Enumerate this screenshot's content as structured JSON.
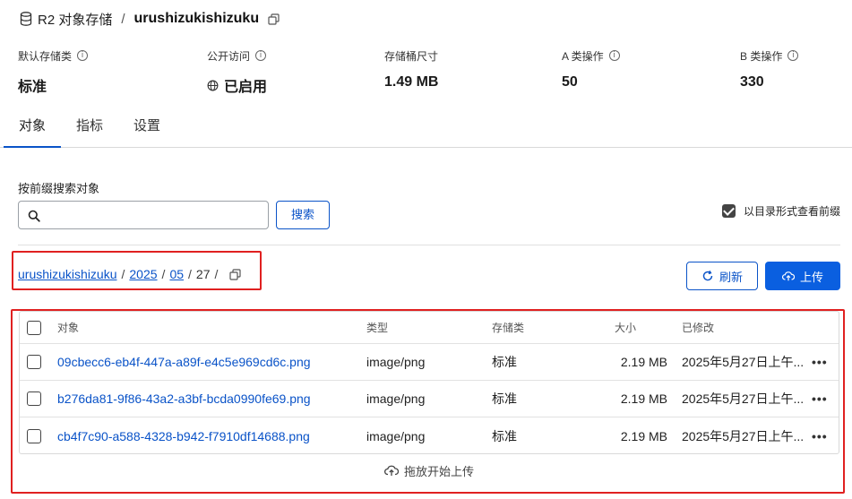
{
  "header": {
    "service": "R2 对象存储",
    "separator": "/",
    "bucket_name": "urushizukishizuku"
  },
  "stats": [
    {
      "label": "默认存储类",
      "value": "标准"
    },
    {
      "label": "公开访问",
      "value": "已启用"
    },
    {
      "label": "存储桶尺寸",
      "value": "1.49 MB"
    },
    {
      "label": "A 类操作",
      "value": "50"
    },
    {
      "label": "B 类操作",
      "value": "330"
    }
  ],
  "info_glyph": "i",
  "tabs": [
    "对象",
    "指标",
    "设置"
  ],
  "search": {
    "label": "按前缀搜索对象",
    "value": "",
    "placeholder": "",
    "button": "搜索"
  },
  "directory_view": {
    "label": "以目录形式查看前缀",
    "checked": true
  },
  "path": {
    "segments": [
      "urushizukishizuku",
      "2025",
      "05",
      "27"
    ],
    "slash": "/"
  },
  "actions": {
    "refresh": "刷新",
    "upload": "上传"
  },
  "table": {
    "columns": [
      "对象",
      "类型",
      "存储类",
      "大小",
      "已修改"
    ],
    "rows": [
      {
        "name": "09cbecc6-eb4f-447a-a89f-e4c5e969cd6c.png",
        "type": "image/png",
        "storage": "标准",
        "size": "2.19 MB",
        "modified": "2025年5月27日上午..."
      },
      {
        "name": "b276da81-9f86-43a2-a3bf-bcda0990fe69.png",
        "type": "image/png",
        "storage": "标准",
        "size": "2.19 MB",
        "modified": "2025年5月27日上午..."
      },
      {
        "name": "cb4f7c90-a588-4328-b942-f7910df14688.png",
        "type": "image/png",
        "storage": "标准",
        "size": "2.19 MB",
        "modified": "2025年5月27日上午..."
      }
    ],
    "more_glyph": "•••"
  },
  "drop_zone": "拖放开始上传",
  "colors": {
    "accent": "#0a53c8",
    "primary_button": "#0a5fe0",
    "highlight_border": "#e02020"
  }
}
